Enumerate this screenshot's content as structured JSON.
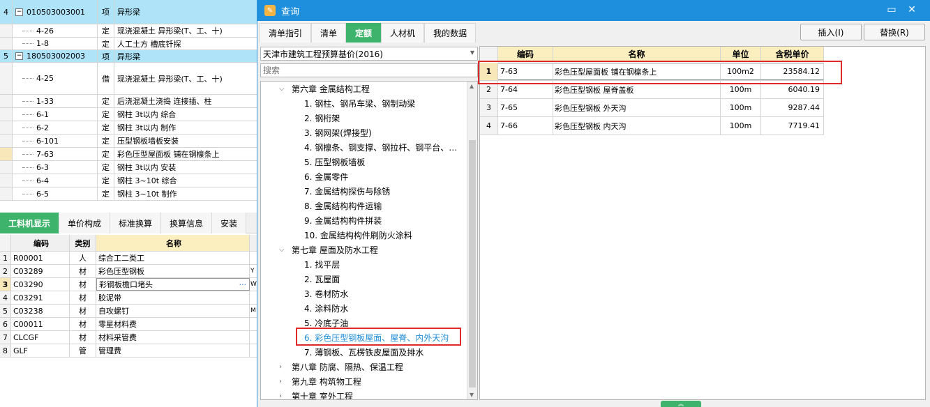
{
  "main_grid": {
    "rows": [
      {
        "num": "4",
        "code": "010503003001",
        "type": "项",
        "name": "异形梁",
        "kind": "group"
      },
      {
        "num": "",
        "code": "4-26",
        "type": "定",
        "name": "现浇混凝土 异形梁(T、工、十)",
        "kind": "child"
      },
      {
        "num": "",
        "code": "1-8",
        "type": "定",
        "name": "人工土方 槽底钎探",
        "kind": "child"
      },
      {
        "num": "5",
        "code": "180503002003",
        "type": "项",
        "name": "异形梁",
        "kind": "group"
      },
      {
        "num": "",
        "code": "4-25",
        "type": "借",
        "name": "现浇混凝土 异形梁(T、工、十)",
        "kind": "child"
      },
      {
        "num": "",
        "code": "1-33",
        "type": "定",
        "name": "后浇混凝土浇捣 连接插、柱",
        "kind": "child"
      },
      {
        "num": "",
        "code": "6-1",
        "type": "定",
        "name": "钢柱 3t以内 综合",
        "kind": "child"
      },
      {
        "num": "",
        "code": "6-2",
        "type": "定",
        "name": "钢柱 3t以内 制作",
        "kind": "child"
      },
      {
        "num": "",
        "code": "6-101",
        "type": "定",
        "name": "压型钢板墙板安装",
        "kind": "child"
      },
      {
        "num": "",
        "code": "7-63",
        "type": "定",
        "name": "彩色压型屋面板 铺在钢檩条上",
        "kind": "child"
      },
      {
        "num": "",
        "code": "6-3",
        "type": "定",
        "name": "钢柱 3t以内 安装",
        "kind": "child"
      },
      {
        "num": "",
        "code": "6-4",
        "type": "定",
        "name": "钢柱 3~10t 综合",
        "kind": "child"
      },
      {
        "num": "",
        "code": "6-5",
        "type": "定",
        "name": "钢柱 3~10t 制作",
        "kind": "child"
      }
    ]
  },
  "bottom_panel": {
    "tabs": [
      "工料机显示",
      "单价构成",
      "标准换算",
      "换算信息",
      "安装"
    ],
    "columns": [
      "编码",
      "类别",
      "名称"
    ],
    "rows": [
      {
        "num": "1",
        "code": "R00001",
        "cat": "人",
        "name": "综合工二类工",
        "extra": ""
      },
      {
        "num": "2",
        "code": "C03289",
        "cat": "材",
        "name": "彩色压型钢板",
        "extra": "Y"
      },
      {
        "num": "3",
        "code": "C03290",
        "cat": "材",
        "name": "彩钢板檐口堵头",
        "extra": "W"
      },
      {
        "num": "4",
        "code": "C03291",
        "cat": "材",
        "name": "胶泥带",
        "extra": ""
      },
      {
        "num": "5",
        "code": "C03238",
        "cat": "材",
        "name": "自攻螺钉",
        "extra": "M"
      },
      {
        "num": "6",
        "code": "C00011",
        "cat": "材",
        "name": "零星材料费",
        "extra": ""
      },
      {
        "num": "7",
        "code": "CLCGF",
        "cat": "材",
        "name": "材料采管费",
        "extra": ""
      },
      {
        "num": "8",
        "code": "GLF",
        "cat": "管",
        "name": "管理费",
        "extra": ""
      }
    ],
    "ellipsis": "···"
  },
  "dialog": {
    "title": "查询",
    "minimize": "▭",
    "close": "✕",
    "tabs": [
      "清单指引",
      "清单",
      "定额",
      "人材机",
      "我的数据"
    ],
    "insert_button": "插入(I)",
    "replace_button": "替换(R)",
    "library": "天津市建筑工程预算基价(2016)",
    "search_placeholder": "搜索",
    "tree": [
      {
        "label": "第六章 金属结构工程",
        "level": 0,
        "expanded": true
      },
      {
        "label": "1. 钢柱、钢吊车梁、钢制动梁",
        "level": 1
      },
      {
        "label": "2. 钢桁架",
        "level": 1
      },
      {
        "label": "3. 钢网架(焊接型)",
        "level": 1
      },
      {
        "label": "4. 钢檩条、钢支撑、钢拉杆、钢平台、…",
        "level": 1
      },
      {
        "label": "5. 压型钢板墙板",
        "level": 1
      },
      {
        "label": "6. 金属零件",
        "level": 1
      },
      {
        "label": "7. 金属结构探伤与除锈",
        "level": 1
      },
      {
        "label": "8. 金属结构构件运输",
        "level": 1
      },
      {
        "label": "9. 金属结构构件拼装",
        "level": 1
      },
      {
        "label": "10. 金属结构构件刷防火涂料",
        "level": 1
      },
      {
        "label": "第七章 屋面及防水工程",
        "level": 0,
        "expanded": true
      },
      {
        "label": "1. 找平层",
        "level": 1
      },
      {
        "label": "2. 瓦屋面",
        "level": 1
      },
      {
        "label": "3. 卷材防水",
        "level": 1
      },
      {
        "label": "4. 涂料防水",
        "level": 1
      },
      {
        "label": "5. 冷底子油",
        "level": 1
      },
      {
        "label": "6. 彩色压型钢板屋面、屋脊、内外天沟",
        "level": 1,
        "selected": true
      },
      {
        "label": "7. 薄钢板、瓦楞铁皮屋面及排水",
        "level": 1
      },
      {
        "label": "第八章 防腐、隔热、保温工程",
        "level": 0
      },
      {
        "label": "第九章 构筑物工程",
        "level": 0
      },
      {
        "label": "第十章 室外工程",
        "level": 0
      }
    ],
    "results": {
      "columns": [
        "编码",
        "名称",
        "单位",
        "含税单价"
      ],
      "rows": [
        {
          "num": "1",
          "code": "7-63",
          "name": "彩色压型屋面板 铺在钢檩条上",
          "unit": "100m2",
          "price": "23584.12"
        },
        {
          "num": "2",
          "code": "7-64",
          "name": "彩色压型钢板 屋脊盖板",
          "unit": "100m",
          "price": "6040.19"
        },
        {
          "num": "3",
          "code": "7-65",
          "name": "彩色压型钢板 外天沟",
          "unit": "100m",
          "price": "9287.44"
        },
        {
          "num": "4",
          "code": "7-66",
          "name": "彩色压型钢板 内天沟",
          "unit": "100m",
          "price": "7719.41"
        }
      ]
    }
  },
  "colors": {
    "accent_green": "#3eb36b",
    "title_blue": "#1e8fdc",
    "highlight_row": "#aee3f8",
    "annotation_red": "#e02a2a"
  }
}
